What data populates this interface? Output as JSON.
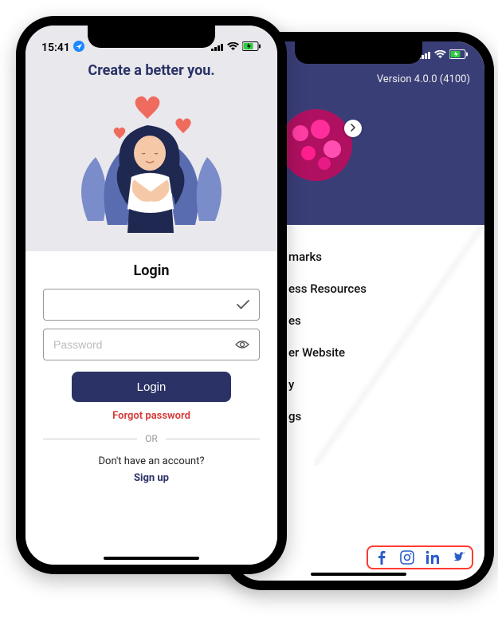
{
  "front": {
    "status_time": "15:41",
    "tagline": "Create a better you.",
    "login_title": "Login",
    "username_value": "",
    "password_placeholder": "Password",
    "login_button": "Login",
    "forgot": "Forgot password",
    "or": "OR",
    "signup_prompt": "Don't have an account?",
    "signup_link": "Sign up"
  },
  "back": {
    "version": "Version 4.0.0 (4100)",
    "menu": [
      {
        "label": "marks"
      },
      {
        "label": "ess Resources"
      },
      {
        "label": "es"
      },
      {
        "label": "er Website"
      },
      {
        "label": "y"
      },
      {
        "label": "gs"
      }
    ]
  },
  "icons": {
    "location": "location-arrow-icon",
    "signal": "signal-icon",
    "wifi": "wifi-icon",
    "battery": "battery-icon",
    "check": "check-icon",
    "eye": "eye-icon",
    "chevron_right": "chevron-right-icon",
    "facebook": "facebook-icon",
    "instagram": "instagram-icon",
    "linkedin": "linkedin-icon",
    "twitter": "twitter-icon"
  },
  "colors": {
    "primary": "#2a3266",
    "danger": "#d63636",
    "header_bg": "#3a3e77",
    "highlight_border": "#ff3b30",
    "social_icon": "#2a5cc9"
  }
}
